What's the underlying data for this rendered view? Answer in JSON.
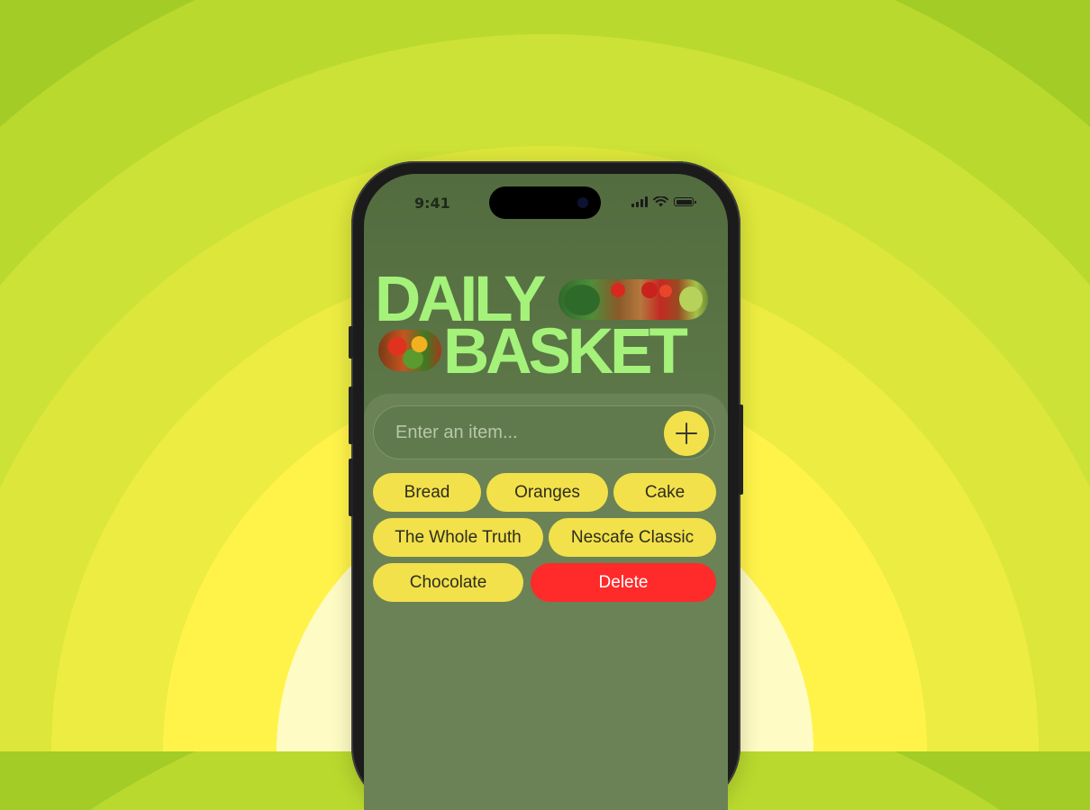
{
  "status_bar": {
    "time": "9:41",
    "icons": [
      "cellular-signal-icon",
      "wifi-icon",
      "battery-icon"
    ]
  },
  "app": {
    "title_line1": "DAILY",
    "title_line2": "BASKET",
    "input": {
      "placeholder": "Enter an item...",
      "value": ""
    },
    "add_button_icon": "plus-icon",
    "items": [
      "Bread",
      "Oranges",
      "Cake",
      "The Whole Truth",
      "Nescafe Classic",
      "Chocolate"
    ],
    "delete_label": "Delete"
  },
  "colors": {
    "title": "#a4f27a",
    "chip": "#f2e14a",
    "delete": "#ff2a2a",
    "screen_bg": "#5f7a4a"
  }
}
